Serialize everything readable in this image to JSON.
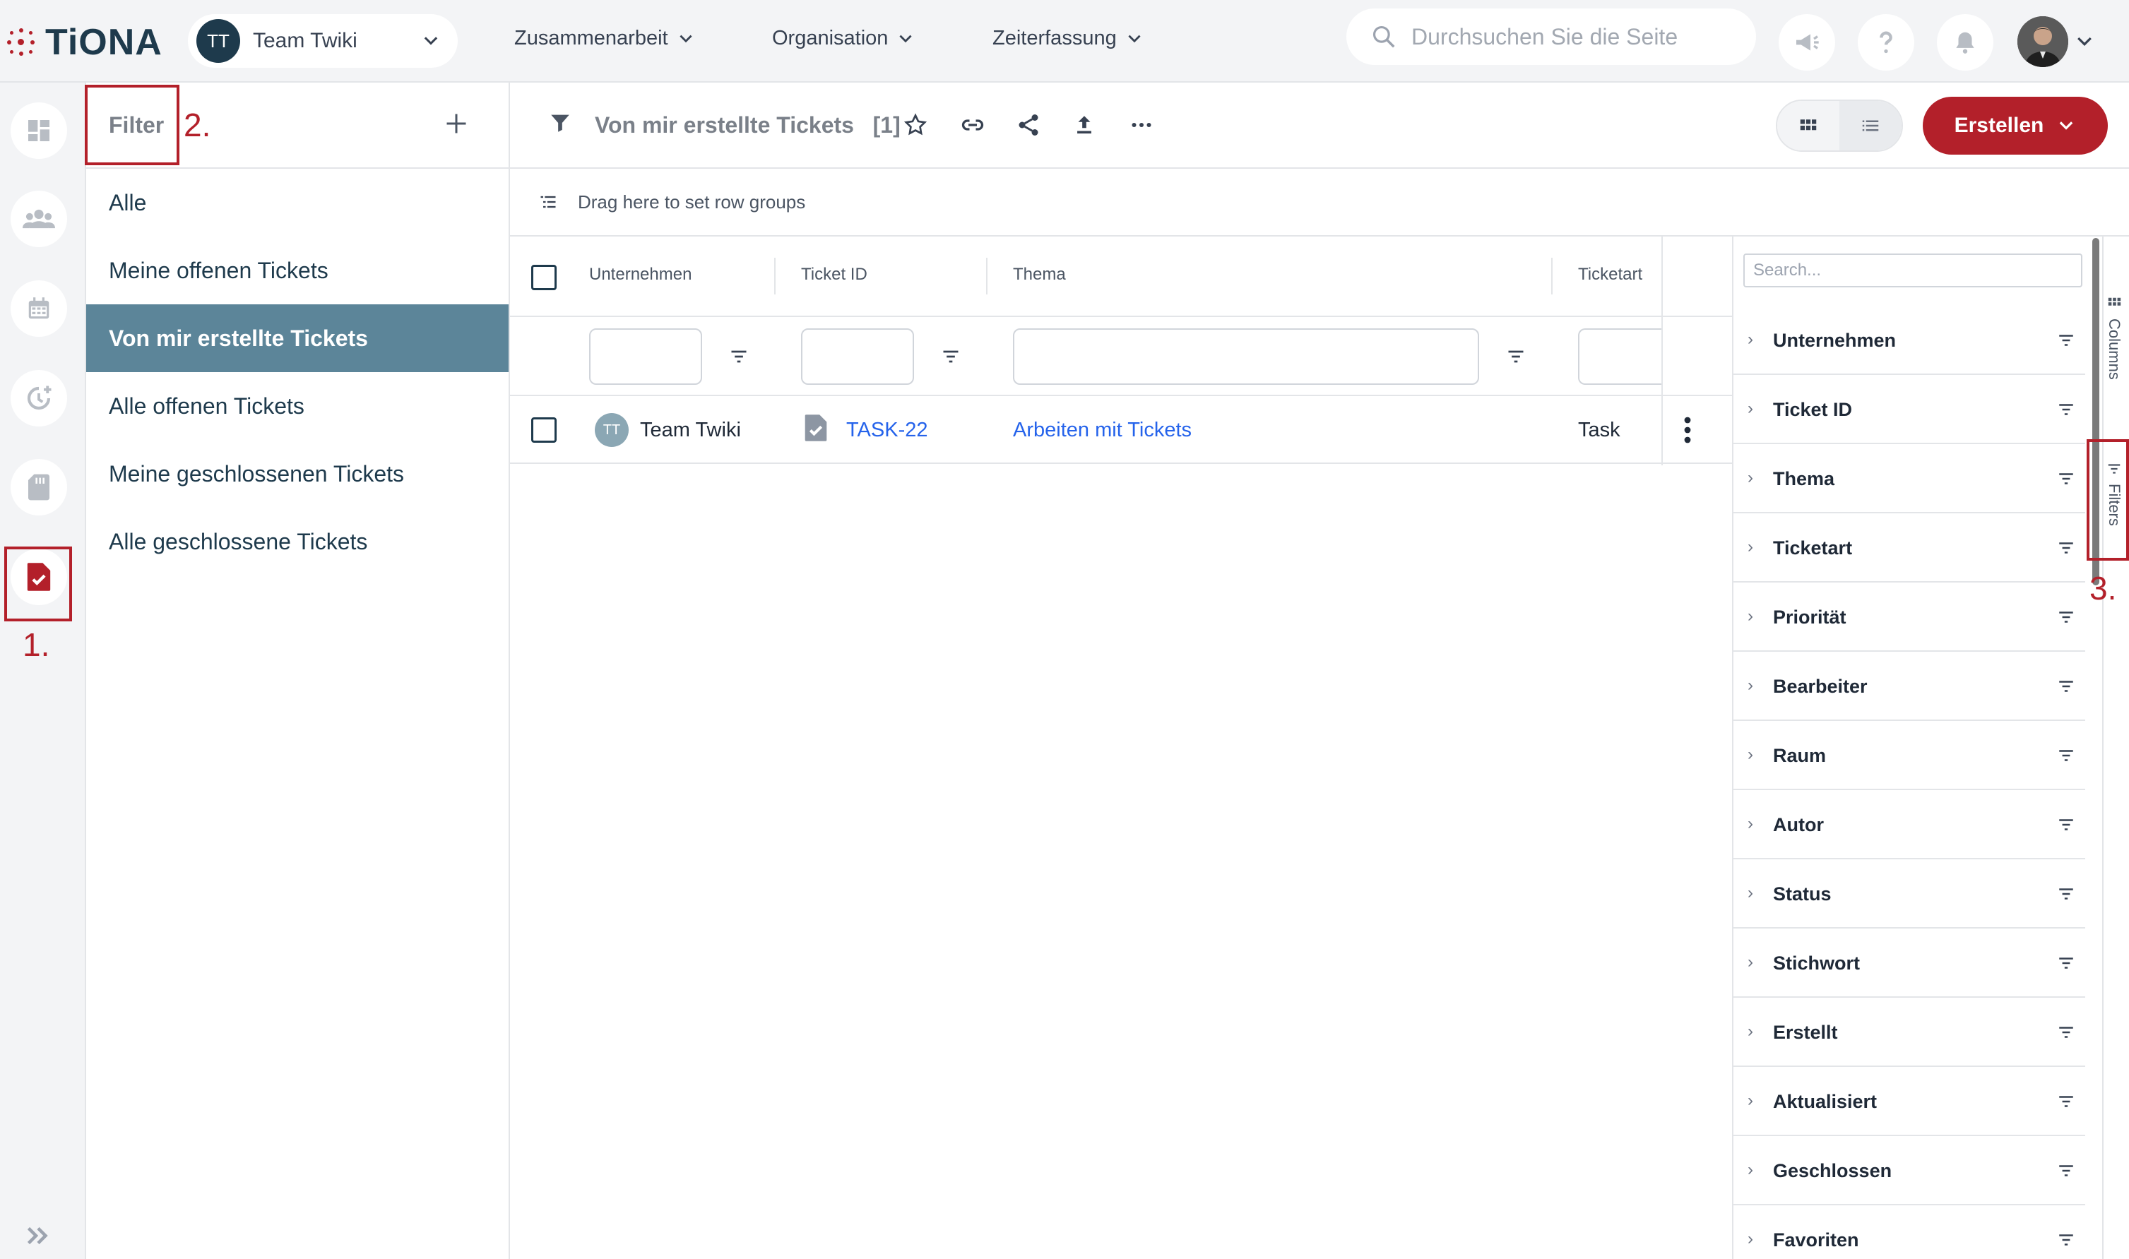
{
  "app": {
    "logo_text": "TiONA"
  },
  "header": {
    "team": {
      "initials": "TT",
      "name": "Team Twiki"
    },
    "nav": [
      {
        "label": "Zusammenarbeit"
      },
      {
        "label": "Organisation"
      },
      {
        "label": "Zeiterfassung"
      }
    ],
    "search_placeholder": "Durchsuchen Sie die Seite"
  },
  "filter_panel": {
    "title": "Filter",
    "items": [
      {
        "label": "Alle",
        "active": false
      },
      {
        "label": "Meine offenen Tickets",
        "active": false
      },
      {
        "label": "Von mir erstellte Tickets",
        "active": true
      },
      {
        "label": "Alle offenen Tickets",
        "active": false
      },
      {
        "label": "Meine geschlossenen Tickets",
        "active": false
      },
      {
        "label": "Alle geschlossene Tickets",
        "active": false
      }
    ]
  },
  "toolbar": {
    "title": "Von mir erstellte Tickets",
    "count": "[1]",
    "create_label": "Erstellen"
  },
  "grid": {
    "row_groups_hint": "Drag here to set row groups",
    "columns": [
      "Unternehmen",
      "Ticket ID",
      "Thema",
      "Ticketart"
    ],
    "rows": [
      {
        "initials": "TT",
        "company": "Team Twiki",
        "ticket_id": "TASK-22",
        "topic": "Arbeiten mit Tickets",
        "type": "Task"
      }
    ]
  },
  "side_panel": {
    "search_placeholder": "Search...",
    "tab_columns": "Columns",
    "tab_filters": "Filters",
    "fields": [
      "Unternehmen",
      "Ticket ID",
      "Thema",
      "Ticketart",
      "Priorität",
      "Bearbeiter",
      "Raum",
      "Autor",
      "Status",
      "Stichwort",
      "Erstellt",
      "Aktualisiert",
      "Geschlossen",
      "Favoriten"
    ]
  },
  "annotations": [
    "1.",
    "2.",
    "3."
  ],
  "colors": {
    "brand_red": "#b3202a",
    "active_filter": "#5c8599",
    "navy": "#1e3a4c",
    "link": "#2563eb"
  }
}
